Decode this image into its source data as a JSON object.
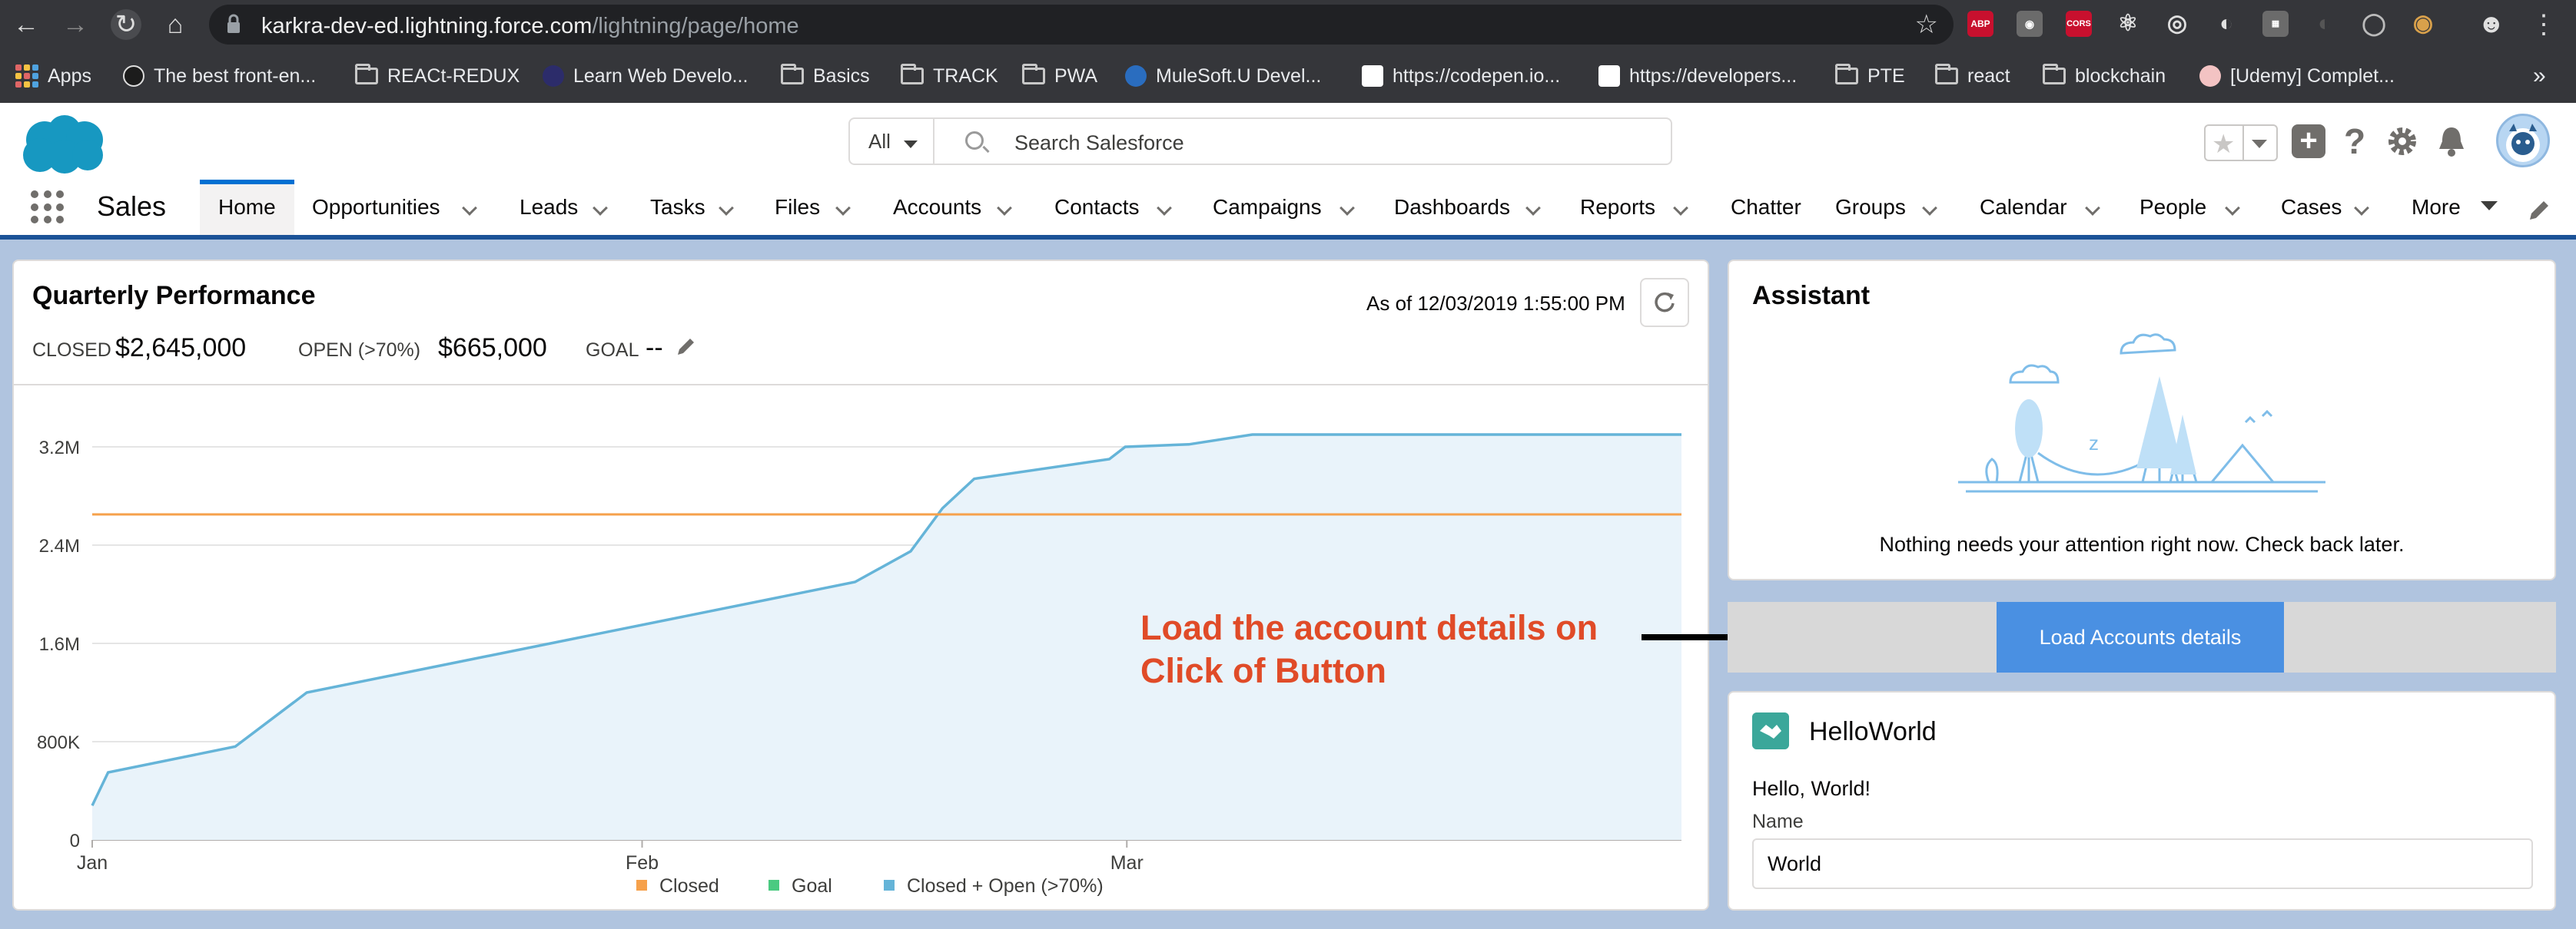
{
  "browser": {
    "url_host": "karkra-dev-ed.lightning.force.com",
    "url_path": "/lightning/page/home",
    "extensions": [
      "ABP",
      "CORS"
    ],
    "bookmarks": [
      {
        "label": "Apps",
        "icon": "apps-grid-icon"
      },
      {
        "label": "The best front-en...",
        "icon": "site-favicon"
      },
      {
        "label": "REACt-REDUX",
        "icon": "folder-icon"
      },
      {
        "label": "Learn Web Develo...",
        "icon": "site-favicon"
      },
      {
        "label": "Basics",
        "icon": "folder-icon"
      },
      {
        "label": "TRACK",
        "icon": "folder-icon"
      },
      {
        "label": "PWA",
        "icon": "folder-icon"
      },
      {
        "label": "MuleSoft.U Devel...",
        "icon": "site-favicon"
      },
      {
        "label": "https://codepen.io...",
        "icon": "site-favicon"
      },
      {
        "label": "https://developers...",
        "icon": "site-favicon"
      },
      {
        "label": "PTE",
        "icon": "folder-icon"
      },
      {
        "label": "react",
        "icon": "folder-icon"
      },
      {
        "label": "blockchain",
        "icon": "folder-icon"
      },
      {
        "label": "[Udemy] Complet...",
        "icon": "site-favicon"
      }
    ]
  },
  "header": {
    "search_scope": "All",
    "search_placeholder": "Search Salesforce"
  },
  "nav": {
    "app_name": "Sales",
    "items": [
      {
        "label": "Home",
        "active": true,
        "has_menu": false
      },
      {
        "label": "Opportunities",
        "has_menu": true
      },
      {
        "label": "Leads",
        "has_menu": true
      },
      {
        "label": "Tasks",
        "has_menu": true
      },
      {
        "label": "Files",
        "has_menu": true
      },
      {
        "label": "Accounts",
        "has_menu": true
      },
      {
        "label": "Contacts",
        "has_menu": true
      },
      {
        "label": "Campaigns",
        "has_menu": true
      },
      {
        "label": "Dashboards",
        "has_menu": true
      },
      {
        "label": "Reports",
        "has_menu": true
      },
      {
        "label": "Chatter",
        "has_menu": false
      },
      {
        "label": "Groups",
        "has_menu": true
      },
      {
        "label": "Calendar",
        "has_menu": true
      },
      {
        "label": "People",
        "has_menu": true
      },
      {
        "label": "Cases",
        "has_menu": true
      },
      {
        "label": "More",
        "has_menu": true
      }
    ]
  },
  "quarterly": {
    "title": "Quarterly Performance",
    "as_of": "As of 12/03/2019 1:55:00 PM",
    "closed_label": "CLOSED",
    "closed_value": "$2,645,000",
    "open_label": "OPEN (>70%)",
    "open_value": "$665,000",
    "goal_label": "GOAL",
    "goal_value": "--"
  },
  "chart_data": {
    "type": "area",
    "title": "",
    "xlabel": "",
    "ylabel": "",
    "x_ticks": [
      "Jan",
      "Feb",
      "Mar"
    ],
    "y_ticks": [
      "0",
      "800K",
      "1.6M",
      "2.4M",
      "3.2M"
    ],
    "ylim": [
      0,
      3.2
    ],
    "xlim": [
      0,
      100
    ],
    "legend": [
      "Closed",
      "Goal",
      "Closed + Open (>70%)"
    ],
    "legend_position": "bottom",
    "series": [
      {
        "name": "Closed + Open (>70%)",
        "color": "#65b4d8",
        "x": [
          0,
          1,
          9,
          13.5,
          48,
          51.5,
          53.5,
          55.5,
          64,
          65,
          69,
          73,
          100
        ],
        "y": [
          0.28,
          0.55,
          0.76,
          1.2,
          2.1,
          2.35,
          2.7,
          2.94,
          3.1,
          3.2,
          3.22,
          3.3,
          3.3
        ]
      },
      {
        "name": "Goal",
        "color": "#f6a14b",
        "x": [
          0,
          100
        ],
        "y": [
          2.65,
          2.65
        ]
      }
    ],
    "legend_colors": [
      "#f6a14b",
      "#4bca81",
      "#65b4d8"
    ]
  },
  "assistant": {
    "title": "Assistant",
    "message": "Nothing needs your attention right now. Check back later."
  },
  "load": {
    "button_label": "Load Accounts details"
  },
  "annotation": {
    "line1": "Load the account details on",
    "line2": "Click of Button"
  },
  "hello": {
    "title": "HelloWorld",
    "greeting": "Hello, World!",
    "name_label": "Name",
    "name_value": "World"
  }
}
